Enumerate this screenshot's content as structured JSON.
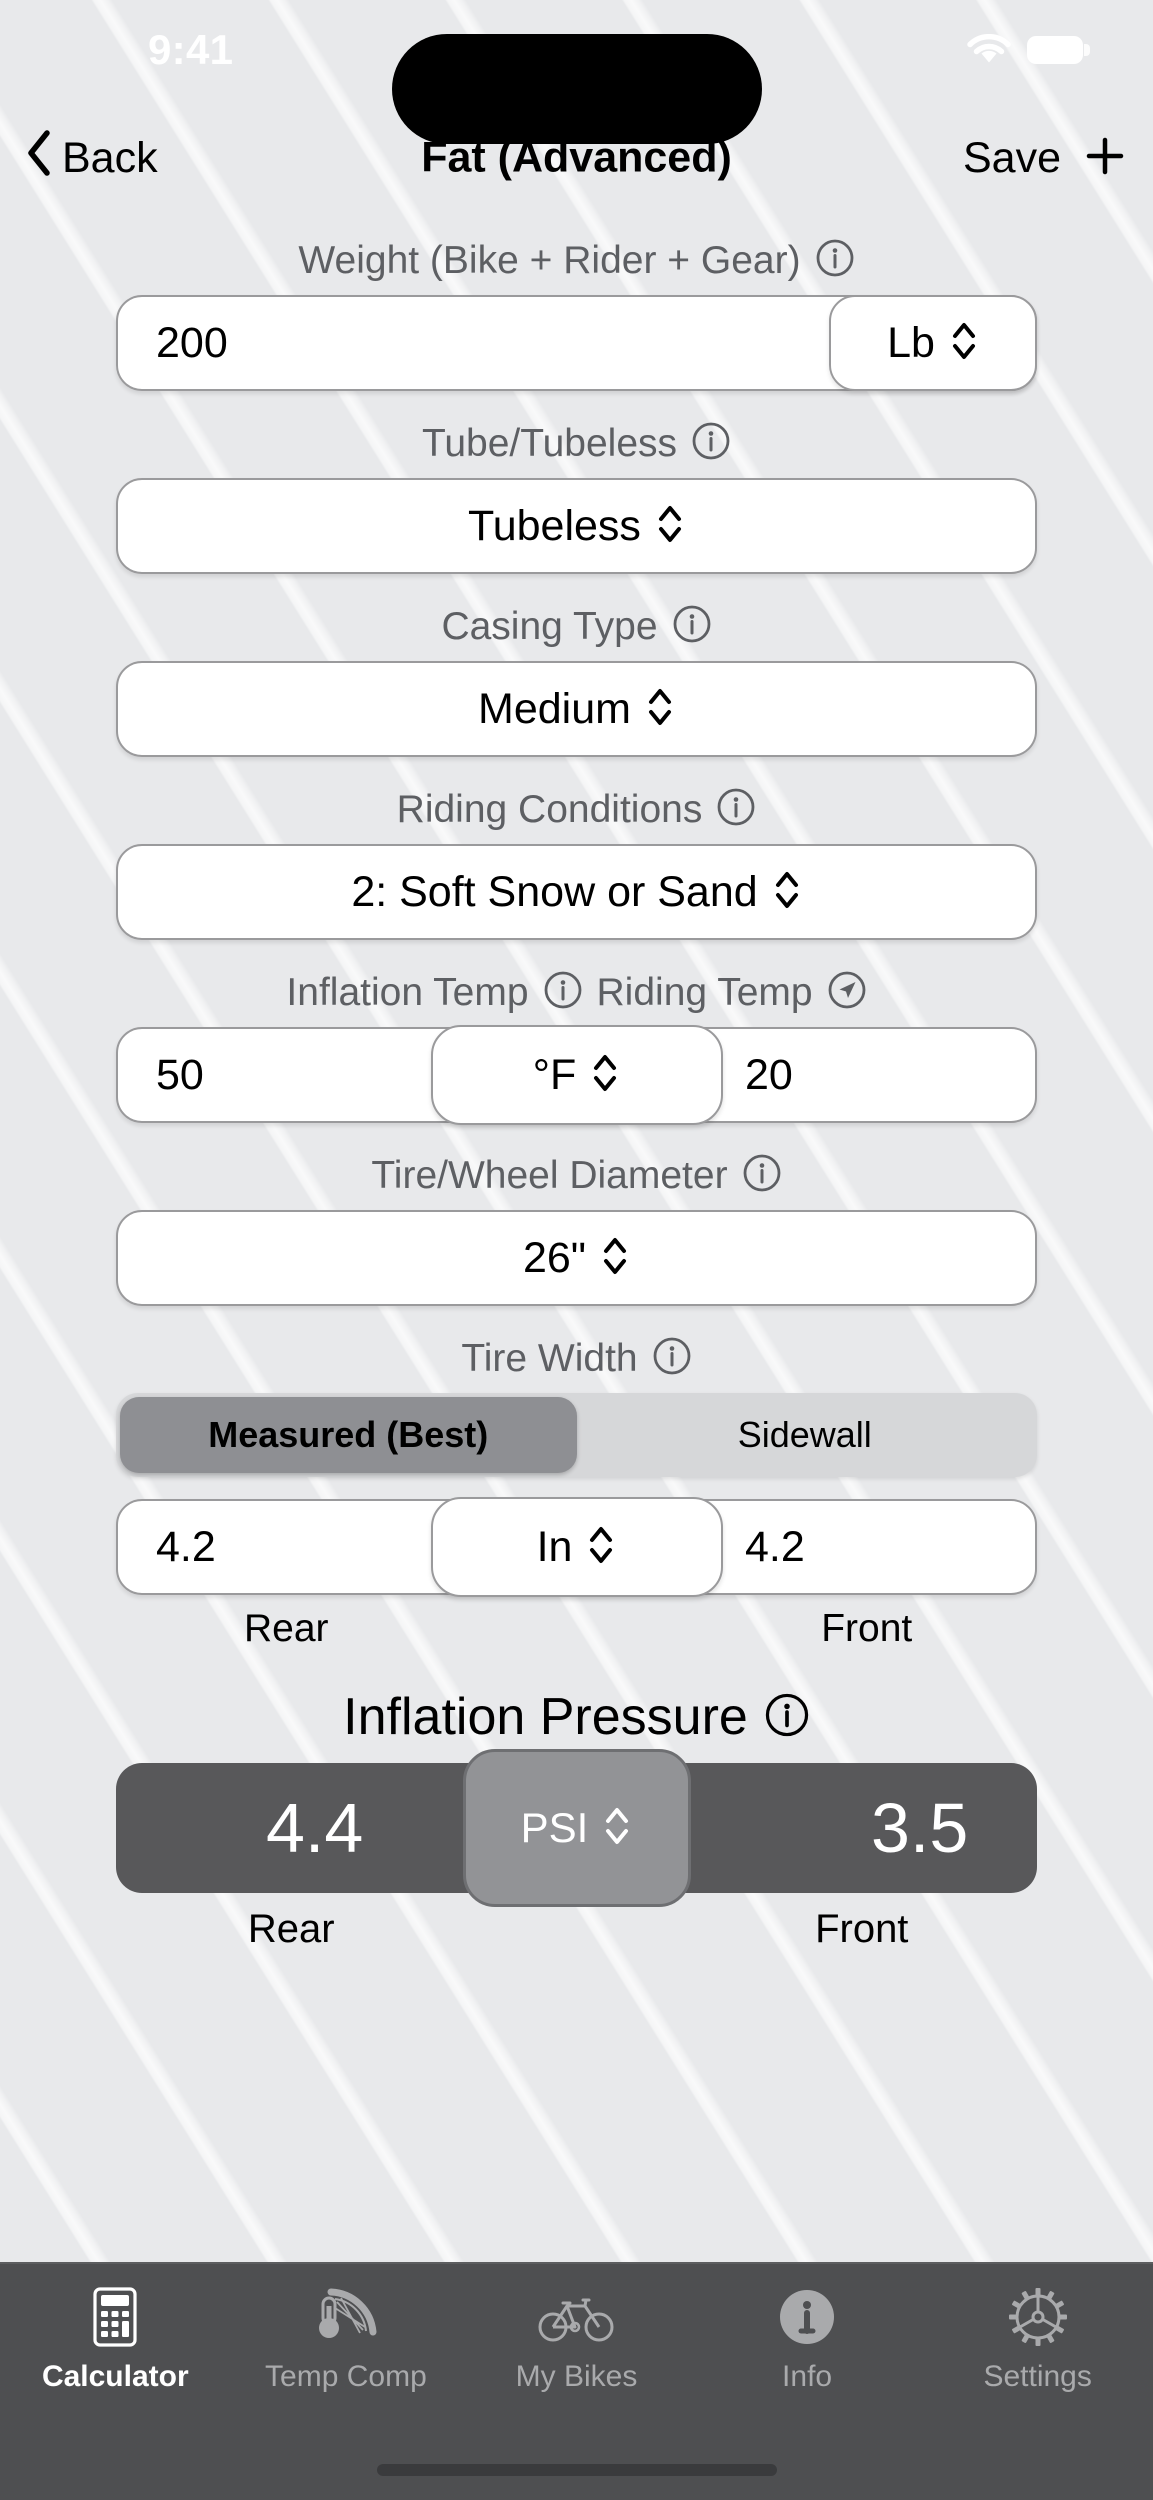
{
  "status_bar": {
    "time": "9:41",
    "wifi_icon": "wifi-icon",
    "battery_icon": "battery-icon"
  },
  "nav": {
    "back_label": "Back",
    "back_icon": "chevron-left-icon",
    "title": "Fat (Advanced)",
    "save_label": "Save",
    "add_icon": "plus-icon"
  },
  "form": {
    "weight": {
      "label": "Weight (Bike + Rider + Gear)",
      "info_icon": "info-icon",
      "value": "200",
      "unit": "Lb",
      "stepper_icon": "up-down-chevron-icon"
    },
    "tube_tubeless": {
      "label": "Tube/Tubeless",
      "info_icon": "info-icon",
      "value": "Tubeless",
      "stepper_icon": "up-down-chevron-icon"
    },
    "casing_type": {
      "label": "Casing Type",
      "info_icon": "info-icon",
      "value": "Medium",
      "stepper_icon": "up-down-chevron-icon"
    },
    "riding_conditions": {
      "label": "Riding Conditions",
      "info_icon": "info-icon",
      "value": "2: Soft Snow or Sand",
      "stepper_icon": "up-down-chevron-icon"
    },
    "temps": {
      "inflation_label": "Inflation Temp",
      "info_icon": "info-icon",
      "riding_label": "Riding Temp",
      "location_icon": "location-arrow-icon",
      "inflation_value": "50",
      "unit": "°F",
      "riding_value": "20",
      "stepper_icon": "up-down-chevron-icon"
    },
    "diameter": {
      "label": "Tire/Wheel Diameter",
      "info_icon": "info-icon",
      "value": "26\"",
      "stepper_icon": "up-down-chevron-icon"
    },
    "tire_width": {
      "label": "Tire Width",
      "info_icon": "info-icon",
      "segments": [
        {
          "label": "Measured (Best)",
          "selected": true
        },
        {
          "label": "Sidewall",
          "selected": false
        }
      ],
      "rear_value": "4.2",
      "unit": "In",
      "front_value": "4.2",
      "stepper_icon": "up-down-chevron-icon",
      "rear_caption": "Rear",
      "front_caption": "Front"
    }
  },
  "result": {
    "title": "Inflation Pressure",
    "info_icon": "info-icon",
    "rear_value": "4.4",
    "unit": "PSI",
    "front_value": "3.5",
    "stepper_icon": "up-down-chevron-icon",
    "rear_caption": "Rear",
    "front_caption": "Front"
  },
  "tab_bar": {
    "items": [
      {
        "label": "Calculator",
        "icon": "calculator-icon",
        "active": true
      },
      {
        "label": "Temp Comp",
        "icon": "thermometer-wheel-icon",
        "active": false
      },
      {
        "label": "My Bikes",
        "icon": "bicycle-icon",
        "active": false
      },
      {
        "label": "Info",
        "icon": "info-filled-icon",
        "active": false
      },
      {
        "label": "Settings",
        "icon": "gear-sprocket-icon",
        "active": false
      }
    ]
  },
  "colors": {
    "background": "#e8e9eb",
    "field_bg": "#ffffff",
    "field_border": "#9a9a9c",
    "label_text": "#5d5f63",
    "result_bar": "#58585a",
    "result_unit_bg": "#929396",
    "segment_track": "#d6d7d9",
    "segment_active": "#8e8f93",
    "tab_bar_bg": "#4e4f51",
    "tab_active_text": "#ffffff",
    "tab_inactive_text": "#a9aaac"
  }
}
